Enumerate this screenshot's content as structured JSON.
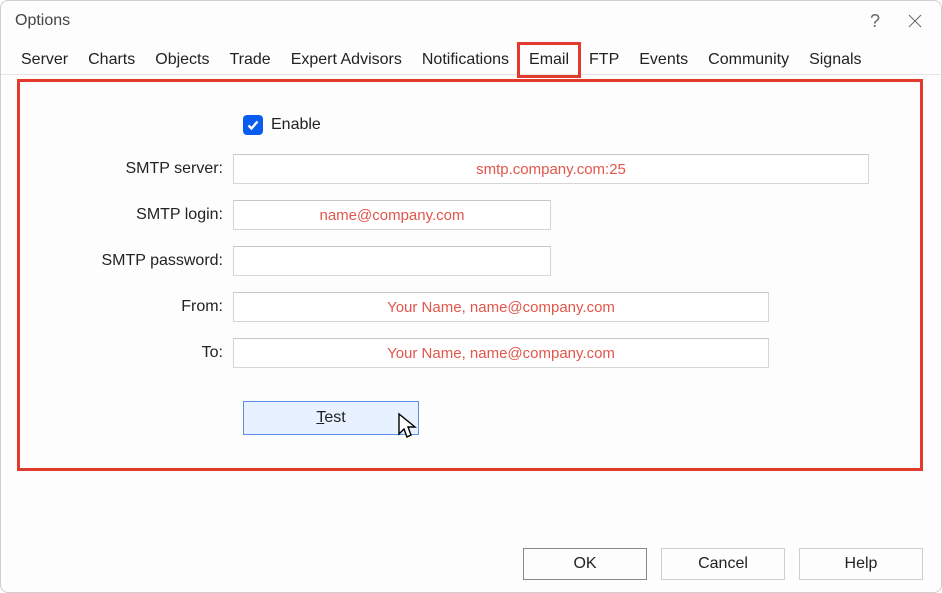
{
  "window": {
    "title": "Options"
  },
  "tabs": {
    "server": "Server",
    "charts": "Charts",
    "objects": "Objects",
    "trade": "Trade",
    "expert_advisors": "Expert Advisors",
    "notifications": "Notifications",
    "email": "Email",
    "ftp": "FTP",
    "events": "Events",
    "community": "Community",
    "signals": "Signals",
    "active": "email"
  },
  "form": {
    "enable_label": "Enable",
    "enable_checked": true,
    "smtp_server_label": "SMTP server:",
    "smtp_server_value": "smtp.company.com:25",
    "smtp_login_label": "SMTP login:",
    "smtp_login_value": "name@company.com",
    "smtp_password_label": "SMTP password:",
    "smtp_password_value": "",
    "from_label": "From:",
    "from_value": "Your Name, name@company.com",
    "to_label": "To:",
    "to_value": "Your Name, name@company.com",
    "test_label_prefix": "T",
    "test_label_rest": "est"
  },
  "footer": {
    "ok": "OK",
    "cancel": "Cancel",
    "help": "Help"
  }
}
